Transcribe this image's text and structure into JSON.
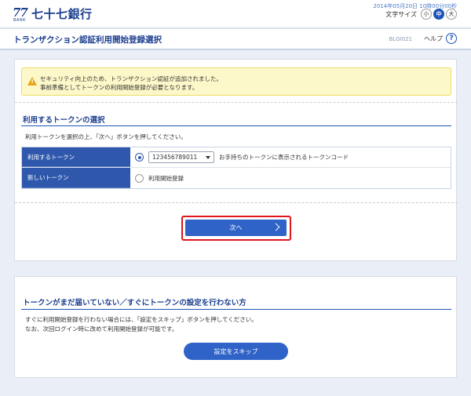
{
  "header": {
    "logo_number": "77",
    "logo_bank": "BANK",
    "bank_name": "七十七銀行",
    "datetime": "2014年05月20日 10時00分00秒",
    "font_size_label": "文字サイズ",
    "font_sizes": [
      "小",
      "中",
      "大"
    ],
    "active_font_size": "中"
  },
  "titlebar": {
    "title": "トランザクション認証利用開始登録選択",
    "screen_id": "BLGI021",
    "help_label": "ヘルプ",
    "help_icon": "?"
  },
  "warning": {
    "line1": "セキュリティ向上のため、トランザクション認証が追加されました。",
    "line2": "事前準備としてトークンの利用開始登録が必要となります。"
  },
  "token_section": {
    "title": "利用するトークンの選択",
    "description": "利用トークンを選択の上、「次へ」ボタンを押してください。",
    "rows": [
      {
        "label": "利用するトークン",
        "selected": true,
        "select_value": "123456789011",
        "hint": "お手持ちのトークンに表示されるトークンコード"
      },
      {
        "label": "新しいトークン",
        "selected": false,
        "option_label": "利用開始登録"
      }
    ],
    "next_label": "次へ"
  },
  "skip_section": {
    "title": "トークンがまだ届いていない／すぐにトークンの設定を行わない方",
    "line1": "すぐに利用開始登録を行わない場合には、「設定をスキップ」ボタンを押してください。",
    "line2": "なお、次回ログイン時に改めて利用開始登録が可能です。",
    "skip_label": "設定をスキップ"
  },
  "colors": {
    "brand": "#1d3f8f",
    "accent": "#2f63c8",
    "highlight": "#e0151d",
    "warning_bg": "#fdf8c9"
  }
}
